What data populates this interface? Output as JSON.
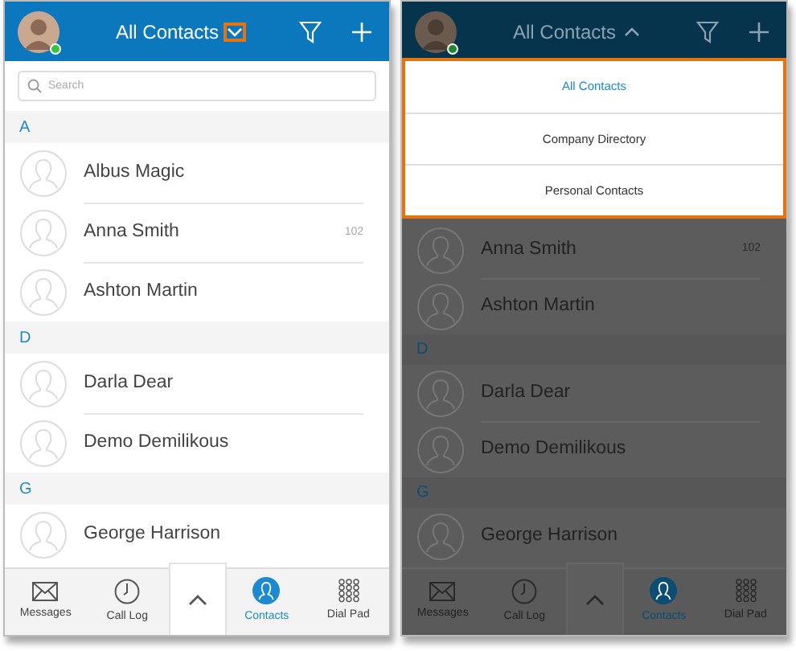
{
  "screens": [
    {
      "dimmed": false,
      "header": {
        "online": true,
        "title": "All Contacts",
        "menu_open": false,
        "highlighted": true
      },
      "search": {
        "placeholder": "Search"
      },
      "sections": [
        {
          "letter": "A",
          "contacts": [
            {
              "name": "Albus Magic"
            },
            {
              "name": "Anna Smith",
              "extension": "102"
            },
            {
              "name": "Ashton Martin"
            }
          ]
        },
        {
          "letter": "D",
          "contacts": [
            {
              "name": "Darla Dear"
            },
            {
              "name": "Demo Demilikous"
            }
          ]
        },
        {
          "letter": "G",
          "contacts": [
            {
              "name": "George Harrison"
            }
          ]
        }
      ],
      "tabs": [
        {
          "kind": "messages",
          "label": "Messages",
          "selected": false
        },
        {
          "kind": "calllog",
          "label": "Call Log",
          "selected": false
        },
        {
          "kind": "more"
        },
        {
          "kind": "contacts",
          "label": "Contacts",
          "selected": true
        },
        {
          "kind": "dialpad",
          "label": "Dial Pad",
          "selected": false
        }
      ]
    },
    {
      "dimmed": true,
      "header": {
        "online": true,
        "title": "All Contacts",
        "menu_open": true,
        "highlighted": false
      },
      "menu": {
        "highlighted": true,
        "items": [
          {
            "label": "All Contacts",
            "selected": true
          },
          {
            "label": "Company Directory",
            "selected": false
          },
          {
            "label": "Personal Contacts",
            "selected": false
          }
        ]
      },
      "sections": [
        {
          "contacts": [
            {
              "name": "Anna Smith",
              "extension": "102"
            },
            {
              "name": "Ashton Martin"
            }
          ]
        },
        {
          "letter": "D",
          "contacts": [
            {
              "name": "Darla Dear"
            },
            {
              "name": "Demo Demilikous"
            }
          ]
        },
        {
          "letter": "G",
          "contacts": [
            {
              "name": "George Harrison"
            }
          ]
        }
      ],
      "tabs": [
        {
          "kind": "messages",
          "label": "Messages",
          "selected": false
        },
        {
          "kind": "calllog",
          "label": "Call Log",
          "selected": false
        },
        {
          "kind": "more"
        },
        {
          "kind": "contacts",
          "label": "Contacts",
          "selected": true
        },
        {
          "kind": "dialpad",
          "label": "Dial Pad",
          "selected": false
        }
      ]
    }
  ]
}
